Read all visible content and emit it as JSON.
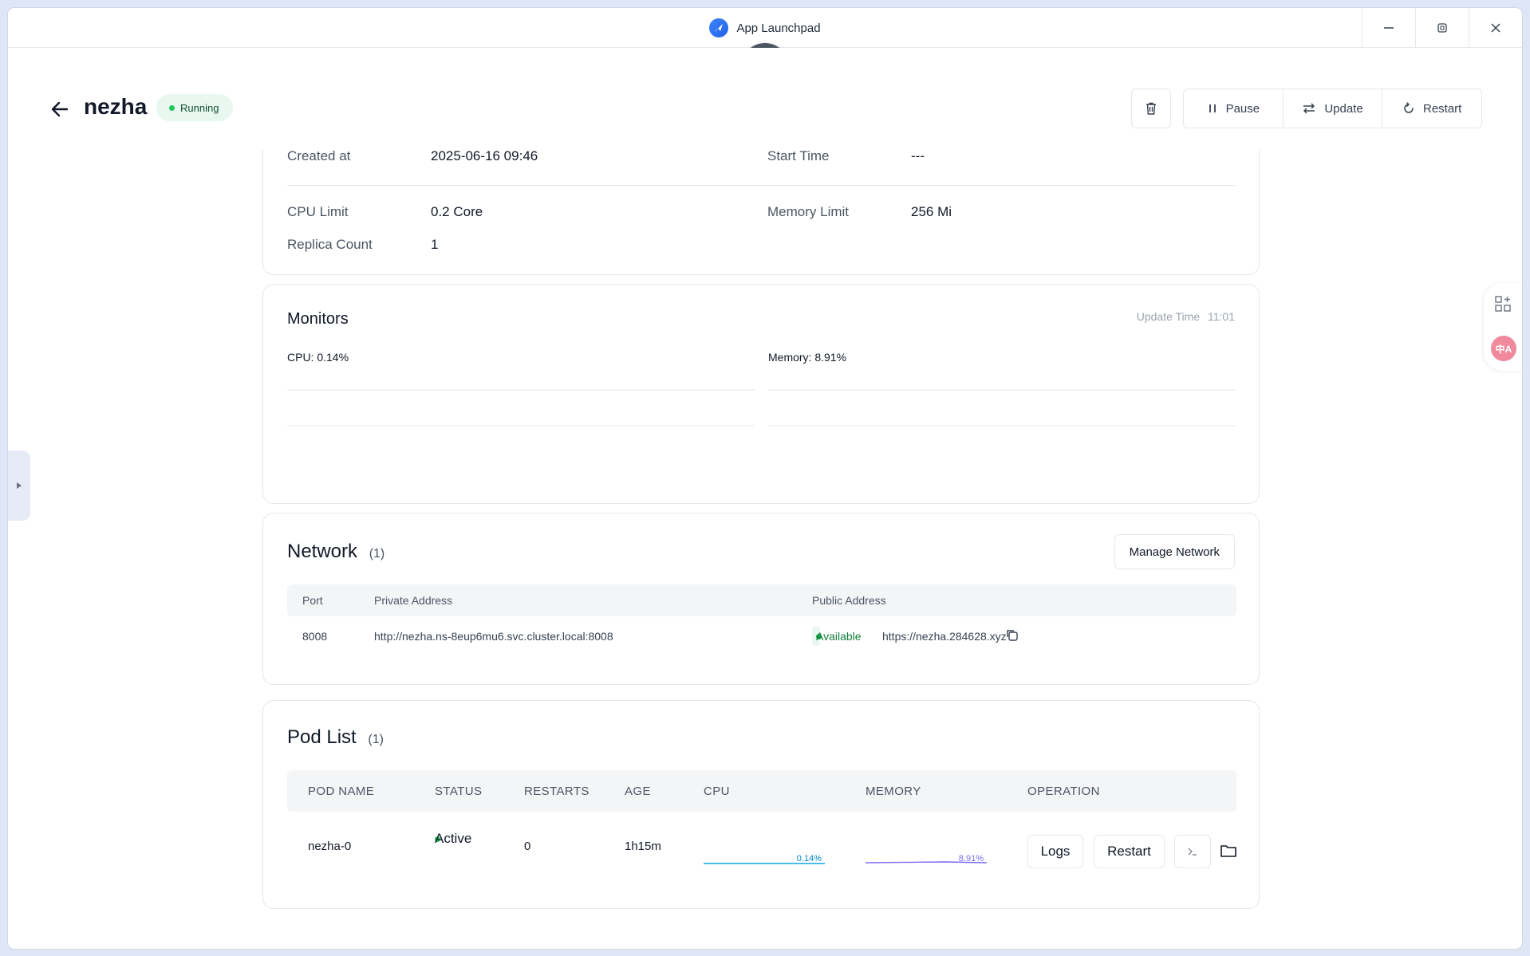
{
  "window": {
    "title": "App Launchpad"
  },
  "header": {
    "app_name": "nezha",
    "status": "Running",
    "actions": {
      "pause": "Pause",
      "update": "Update",
      "restart": "Restart"
    }
  },
  "info": {
    "created_label": "Created at",
    "created_value": "2025-06-16 09:46",
    "start_label": "Start Time",
    "start_value": "---",
    "cpu_limit_label": "CPU Limit",
    "cpu_limit_value": "0.2 Core",
    "memory_limit_label": "Memory Limit",
    "memory_limit_value": "256 Mi",
    "replica_label": "Replica Count",
    "replica_value": "1"
  },
  "monitors": {
    "title": "Monitors",
    "update_label": "Update Time",
    "update_value": "11:01",
    "cpu_label": "CPU:",
    "cpu_value": "0.14%",
    "memory_label": "Memory:",
    "memory_value": "8.91%",
    "colors": {
      "cpu": "#6366f1",
      "memory": "#6366f1"
    }
  },
  "network": {
    "title": "Network",
    "count": "(1)",
    "manage_button": "Manage Network",
    "columns": [
      "Port",
      "Private Address",
      "Public Address"
    ],
    "rows": [
      {
        "port": "8008",
        "private_address": "http://nezha.ns-8eup6mu6.svc.cluster.local:8008",
        "availability": "Available",
        "public_address": "https://nezha.284628.xyz"
      }
    ]
  },
  "pods": {
    "title": "Pod List",
    "count": "(1)",
    "columns": [
      "POD NAME",
      "STATUS",
      "RESTARTS",
      "AGE",
      "CPU",
      "MEMORY",
      "OPERATION"
    ],
    "rows": [
      {
        "name": "nezha-0",
        "status": "Active",
        "restarts": "0",
        "age": "1h15m",
        "cpu": "0.14%",
        "memory": "8.91%",
        "logs_button": "Logs",
        "restart_button": "Restart"
      }
    ],
    "colors": {
      "cpu": "#0ea5e9",
      "memory": "#7c6cf0"
    }
  },
  "icons": {
    "close": "close-icon",
    "back": "arrow-left-icon",
    "trash": "trash-icon",
    "pause": "pause-icon",
    "update": "swap-icon",
    "restart": "refresh-icon",
    "copy": "copy-icon",
    "terminal": "terminal-icon",
    "folder": "folder-icon",
    "apps": "apps-add-icon",
    "translate": "translate-icon"
  },
  "side_tools": {
    "translate_text": "中A"
  }
}
